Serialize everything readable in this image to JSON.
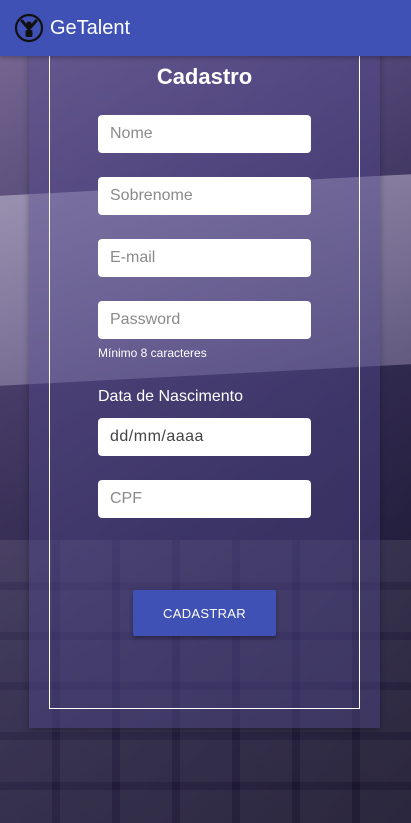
{
  "app": {
    "title": "GeTalent",
    "logo_icon": "talent-logo-icon",
    "colors": {
      "primary": "#3f51b5",
      "on_primary": "#ffffff"
    }
  },
  "form": {
    "title": "Cadastro",
    "fields": {
      "first_name": {
        "placeholder": "Nome"
      },
      "last_name": {
        "placeholder": "Sobrenome"
      },
      "email": {
        "placeholder": "E-mail"
      },
      "password": {
        "placeholder": "Password"
      },
      "birth_date": {
        "value": "dd/mm/aaaa"
      },
      "cpf": {
        "placeholder": "CPF"
      }
    },
    "password_hint": "Mínimo 8 caracteres",
    "birth_date_label": "Data de Nascimento",
    "submit_label": "CADASTRAR"
  }
}
